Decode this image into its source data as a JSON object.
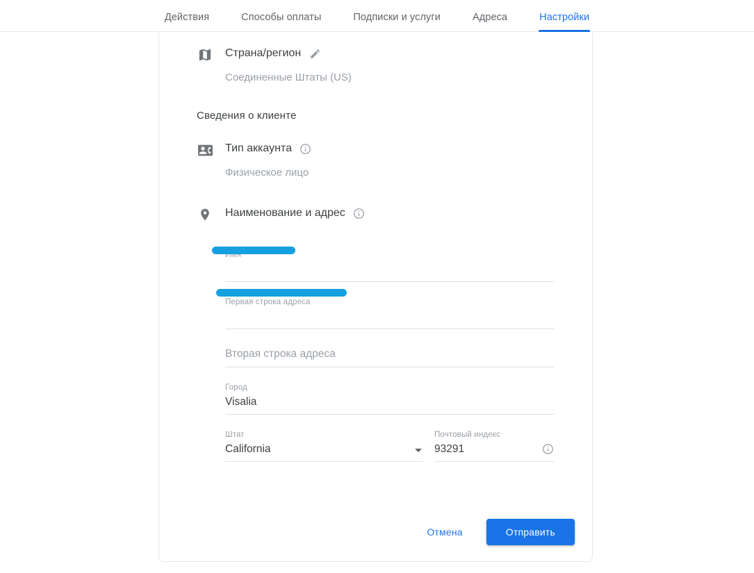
{
  "tabs": [
    {
      "label": "Действия",
      "active": false
    },
    {
      "label": "Способы оплаты",
      "active": false
    },
    {
      "label": "Подписки и услуги",
      "active": false
    },
    {
      "label": "Адреса",
      "active": false
    },
    {
      "label": "Настройки",
      "active": true
    }
  ],
  "colors": {
    "accent": "#1a73e8",
    "redaction": "#15a0e0",
    "label_grey": "#9aa0a6",
    "text_primary": "#3c4043"
  },
  "country_section": {
    "icon": "map-icon",
    "title": "Страна/регион",
    "edit_icon": "pencil-icon",
    "value": "Соединенные Штаты (US)"
  },
  "customer_section": {
    "heading": "Сведения о клиенте",
    "account_type": {
      "icon": "contact-card-icon",
      "title": "Тип аккаунта",
      "info_icon": "info-icon",
      "value": "Физическое лицо"
    },
    "name_and_address": {
      "icon": "location-pin-icon",
      "title": "Наименование и адрес",
      "info_icon": "info-icon",
      "fields": {
        "name": {
          "label": "Имя",
          "value": "",
          "redacted": true
        },
        "address_line1": {
          "label": "Первая строка адреса",
          "value": "",
          "redacted": true
        },
        "address_line2": {
          "label": "",
          "placeholder": "Вторая строка адреса",
          "value": ""
        },
        "city": {
          "label": "Город",
          "value": "Visalia"
        },
        "state": {
          "label": "Штат",
          "value": "California",
          "dropdown_icon": "chevron-down-icon"
        },
        "postal_code": {
          "label": "Почтовый индекс",
          "value": "93291",
          "info_icon": "info-icon"
        }
      }
    }
  },
  "actions": {
    "cancel_label": "Отмена",
    "submit_label": "Отправить"
  }
}
